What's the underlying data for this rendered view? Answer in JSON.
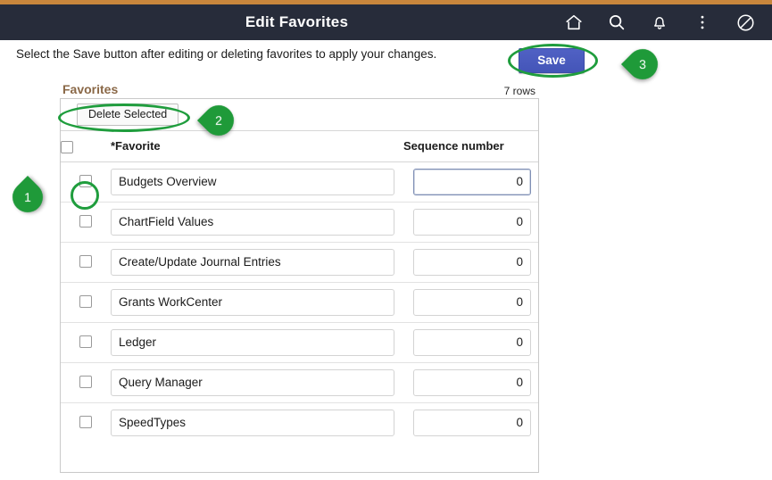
{
  "header": {
    "title": "Edit Favorites",
    "accent_strip_color": "#c8863c",
    "bar_color": "#272c3a",
    "icons": [
      {
        "name": "home-icon",
        "label": "Home"
      },
      {
        "name": "search-icon",
        "label": "Search"
      },
      {
        "name": "bell-icon",
        "label": "Notifications"
      },
      {
        "name": "kebab-menu-icon",
        "label": "Actions"
      },
      {
        "name": "navbar-compass-icon",
        "label": "NavBar"
      }
    ]
  },
  "instruction": "Select the Save button after editing or deleting favorites to apply your changes.",
  "toolbar": {
    "save_label": "Save",
    "save_color": "#4a5bbd"
  },
  "grid": {
    "section_title": "Favorites",
    "section_title_color": "#8a6847",
    "rows_count": "7 rows",
    "delete_selected_label": "Delete Selected",
    "columns": {
      "select_all": "",
      "favorite": "*Favorite",
      "sequence": "Sequence number"
    },
    "rows": [
      {
        "checked": false,
        "favorite": "Budgets Overview",
        "sequence": "0",
        "seq_focused": true
      },
      {
        "checked": false,
        "favorite": "ChartField Values",
        "sequence": "0",
        "seq_focused": false
      },
      {
        "checked": false,
        "favorite": "Create/Update Journal Entries",
        "sequence": "0",
        "seq_focused": false
      },
      {
        "checked": false,
        "favorite": "Grants WorkCenter",
        "sequence": "0",
        "seq_focused": false
      },
      {
        "checked": false,
        "favorite": "Ledger",
        "sequence": "0",
        "seq_focused": false
      },
      {
        "checked": false,
        "favorite": "Query Manager",
        "sequence": "0",
        "seq_focused": false
      },
      {
        "checked": false,
        "favorite": "SpeedTypes",
        "sequence": "0",
        "seq_focused": false
      }
    ]
  },
  "annotations": {
    "color": "#1f9a39",
    "steps": [
      {
        "number": "1",
        "direction": "right",
        "target": "row-checkbox"
      },
      {
        "number": "2",
        "direction": "left",
        "target": "delete-selected-button"
      },
      {
        "number": "3",
        "direction": "left",
        "target": "save-button"
      }
    ]
  }
}
